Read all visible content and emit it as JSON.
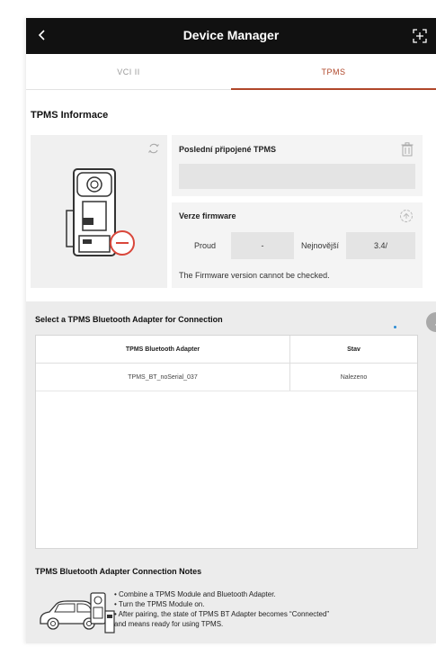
{
  "header": {
    "title": "Device Manager",
    "back_icon": "chevron-left-icon",
    "expand_icon": "expand-icon"
  },
  "tabs": [
    {
      "label": "VCI II",
      "active": false
    },
    {
      "label": "TPMS",
      "active": true
    }
  ],
  "accent_color": "#b0472a",
  "section_title": "TPMS Informace",
  "last_connected": {
    "label": "Poslední připojené TPMS",
    "value": ""
  },
  "firmware": {
    "label": "Verze firmware",
    "current_label": "Proud",
    "current_value": "-",
    "latest_label": "Nejnovější",
    "latest_value": "3.4/",
    "note": "The Firmware version cannot be checked."
  },
  "adapter_section": {
    "title": "Select a TPMS Bluetooth Adapter for Connection",
    "columns": [
      "TPMS Bluetooth Adapter",
      "Stav"
    ],
    "rows": [
      {
        "name": "TPMS_BT_noSerial_037",
        "status": "Nalezeno"
      }
    ]
  },
  "notes": {
    "title": "TPMS Bluetooth Adapter Connection Notes",
    "items": [
      "• Combine a TPMS Module and Bluetooth Adapter.",
      "• Turn the TPMS Module on.",
      "• After pairing, the state of TPMS BT Adapter becomes “Connected”",
      "and means ready for using TPMS."
    ]
  }
}
